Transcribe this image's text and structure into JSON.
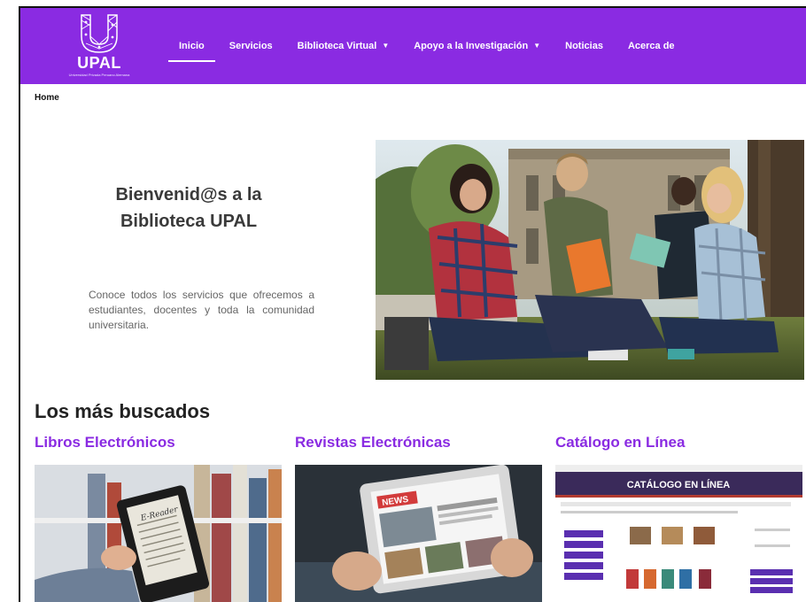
{
  "brand": {
    "name": "UPAL",
    "tagline": "Universidad Privada Peruano Alemana",
    "color": "#8a2be2"
  },
  "nav": {
    "items": [
      {
        "label": "Inicio",
        "active": true,
        "dropdown": false
      },
      {
        "label": "Servicios",
        "active": false,
        "dropdown": false
      },
      {
        "label": "Biblioteca Virtual",
        "active": false,
        "dropdown": true
      },
      {
        "label": "Apoyo a la Investigación",
        "active": false,
        "dropdown": true
      },
      {
        "label": "Noticias",
        "active": false,
        "dropdown": false
      },
      {
        "label": "Acerca de",
        "active": false,
        "dropdown": false
      }
    ]
  },
  "breadcrumb": {
    "current": "Home"
  },
  "hero": {
    "title_line1": "Bienvenid@s a la",
    "title_line2": "Biblioteca UPAL",
    "description": "Conoce todos los servicios que ofrecemos a estudiantes, docentes y toda la comunidad universitaria."
  },
  "section": {
    "title": "Los más buscados",
    "cards": [
      {
        "title": "Libros Electrónicos",
        "image_label": "E-Reader"
      },
      {
        "title": "Revistas Electrónicas",
        "image_label": "NEWS"
      },
      {
        "title": "Catálogo en Línea",
        "image_label": "CATÁLOGO EN LÍNEA"
      }
    ]
  }
}
